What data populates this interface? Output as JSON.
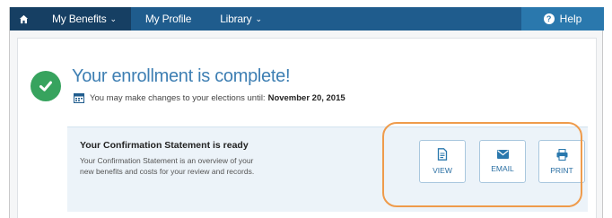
{
  "nav": {
    "home_icon": "home-icon",
    "items": [
      {
        "label": "My Benefits",
        "chevron": "⌄"
      },
      {
        "label": "My Profile"
      },
      {
        "label": "Library",
        "chevron": "⌄"
      }
    ],
    "help_label": "Help",
    "help_glyph": "?"
  },
  "colors": {
    "nav_bg": "#1f5c8d",
    "nav_active": "#163f63",
    "help_bg": "#2a78ad",
    "success": "#37a35e",
    "title": "#3e7fb3",
    "highlight": "#ef9b4b"
  },
  "main": {
    "title": "Your enrollment is complete!",
    "subtitle_prefix": "You may make changes to your elections until:",
    "deadline": "November 20, 2015"
  },
  "statement": {
    "title": "Your Confirmation Statement is ready",
    "description": "Your Confirmation Statement is an overview of your new benefits and costs for your review and records.",
    "actions": [
      {
        "label": "VIEW",
        "icon": "document-icon"
      },
      {
        "label": "EMAIL",
        "icon": "envelope-icon"
      },
      {
        "label": "PRINT",
        "icon": "printer-icon"
      }
    ]
  }
}
